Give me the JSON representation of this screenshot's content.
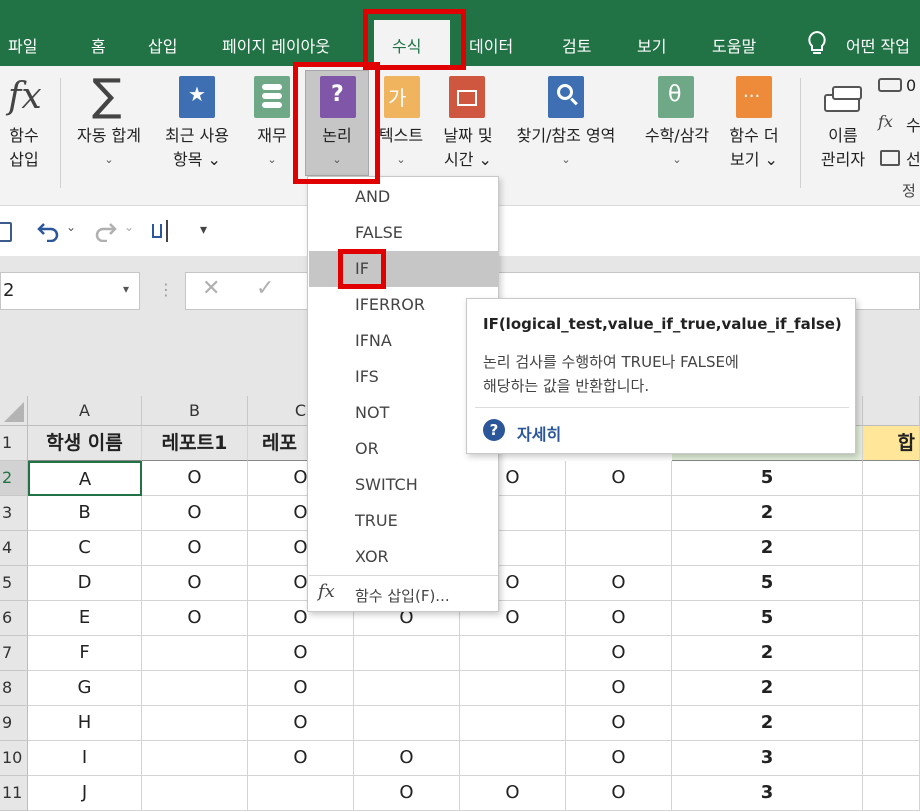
{
  "tabs": {
    "file": "파일",
    "home": "홈",
    "insert": "삽입",
    "page_layout": "페이지 레이아웃",
    "formulas": "수식",
    "data": "데이터",
    "review": "검토",
    "view": "보기",
    "help": "도움말",
    "tell_me": "어떤 작업"
  },
  "ribbon": {
    "insert_function": [
      "함수",
      "삽입"
    ],
    "autosum": [
      "자동 합계",
      "⌄"
    ],
    "recent": [
      "최근 사용",
      "항목 ⌄"
    ],
    "financial": [
      "재무",
      "⌄"
    ],
    "logical": [
      "논리",
      "⌄"
    ],
    "text": [
      "텍스트",
      "⌄"
    ],
    "datetime": [
      "날짜 및",
      "시간 ⌄"
    ],
    "lookup": [
      "찾기/참조 영역",
      "⌄"
    ],
    "math": [
      "수학/삼각",
      "⌄"
    ],
    "more": [
      "함수 더",
      "보기 ⌄"
    ],
    "name_manager": [
      "이름",
      "관리자"
    ],
    "side_1": "0",
    "side_2": "수",
    "side_3": "선",
    "group_label": "정",
    "icon_text_ga": "가"
  },
  "namebox": {
    "value": "2",
    "arrow": "▾"
  },
  "logical_menu": {
    "items": [
      "AND",
      "FALSE",
      "IF",
      "IFERROR",
      "IFNA",
      "IFS",
      "NOT",
      "OR",
      "SWITCH",
      "TRUE",
      "XOR"
    ],
    "selected": "IF",
    "insert_function": "함수 삽입(F)..."
  },
  "tooltip": {
    "signature": "IF(logical_test,value_if_true,value_if_false)",
    "desc1": "논리 검사를 수행하여 TRUE나 FALSE에",
    "desc2": "해당하는 값을 반환합니다.",
    "more": "자세히"
  },
  "grid": {
    "columns": [
      "A",
      "B",
      "C"
    ],
    "header_row": [
      "학생 이름",
      "레포트1",
      "레포"
    ],
    "rows": [
      {
        "num": "2",
        "cells": [
          "A",
          "O",
          "O",
          "",
          "O",
          "O",
          "5"
        ]
      },
      {
        "num": "3",
        "cells": [
          "B",
          "O",
          "O",
          "",
          "",
          "",
          "2"
        ]
      },
      {
        "num": "4",
        "cells": [
          "C",
          "O",
          "O",
          "",
          "",
          "",
          "2"
        ]
      },
      {
        "num": "5",
        "cells": [
          "D",
          "O",
          "O",
          "",
          "O",
          "O",
          "5"
        ]
      },
      {
        "num": "6",
        "cells": [
          "E",
          "O",
          "O",
          "O",
          "O",
          "O",
          "5"
        ]
      },
      {
        "num": "7",
        "cells": [
          "F",
          "",
          "O",
          "",
          "",
          "O",
          "2"
        ]
      },
      {
        "num": "8",
        "cells": [
          "G",
          "",
          "O",
          "",
          "",
          "O",
          "2"
        ]
      },
      {
        "num": "9",
        "cells": [
          "H",
          "",
          "O",
          "",
          "",
          "O",
          "2"
        ]
      },
      {
        "num": "10",
        "cells": [
          "I",
          "",
          "O",
          "O",
          "",
          "O",
          "3"
        ]
      },
      {
        "num": "11",
        "cells": [
          "J",
          "",
          "",
          "O",
          "O",
          "O",
          "3"
        ]
      }
    ],
    "row_numbers": [
      "1"
    ],
    "partial_header": "합"
  },
  "colors": {
    "tab_green": "#217346",
    "highlight_red": "#e00000",
    "header_gold": "#ffe699",
    "header_green": "#e2efda"
  }
}
